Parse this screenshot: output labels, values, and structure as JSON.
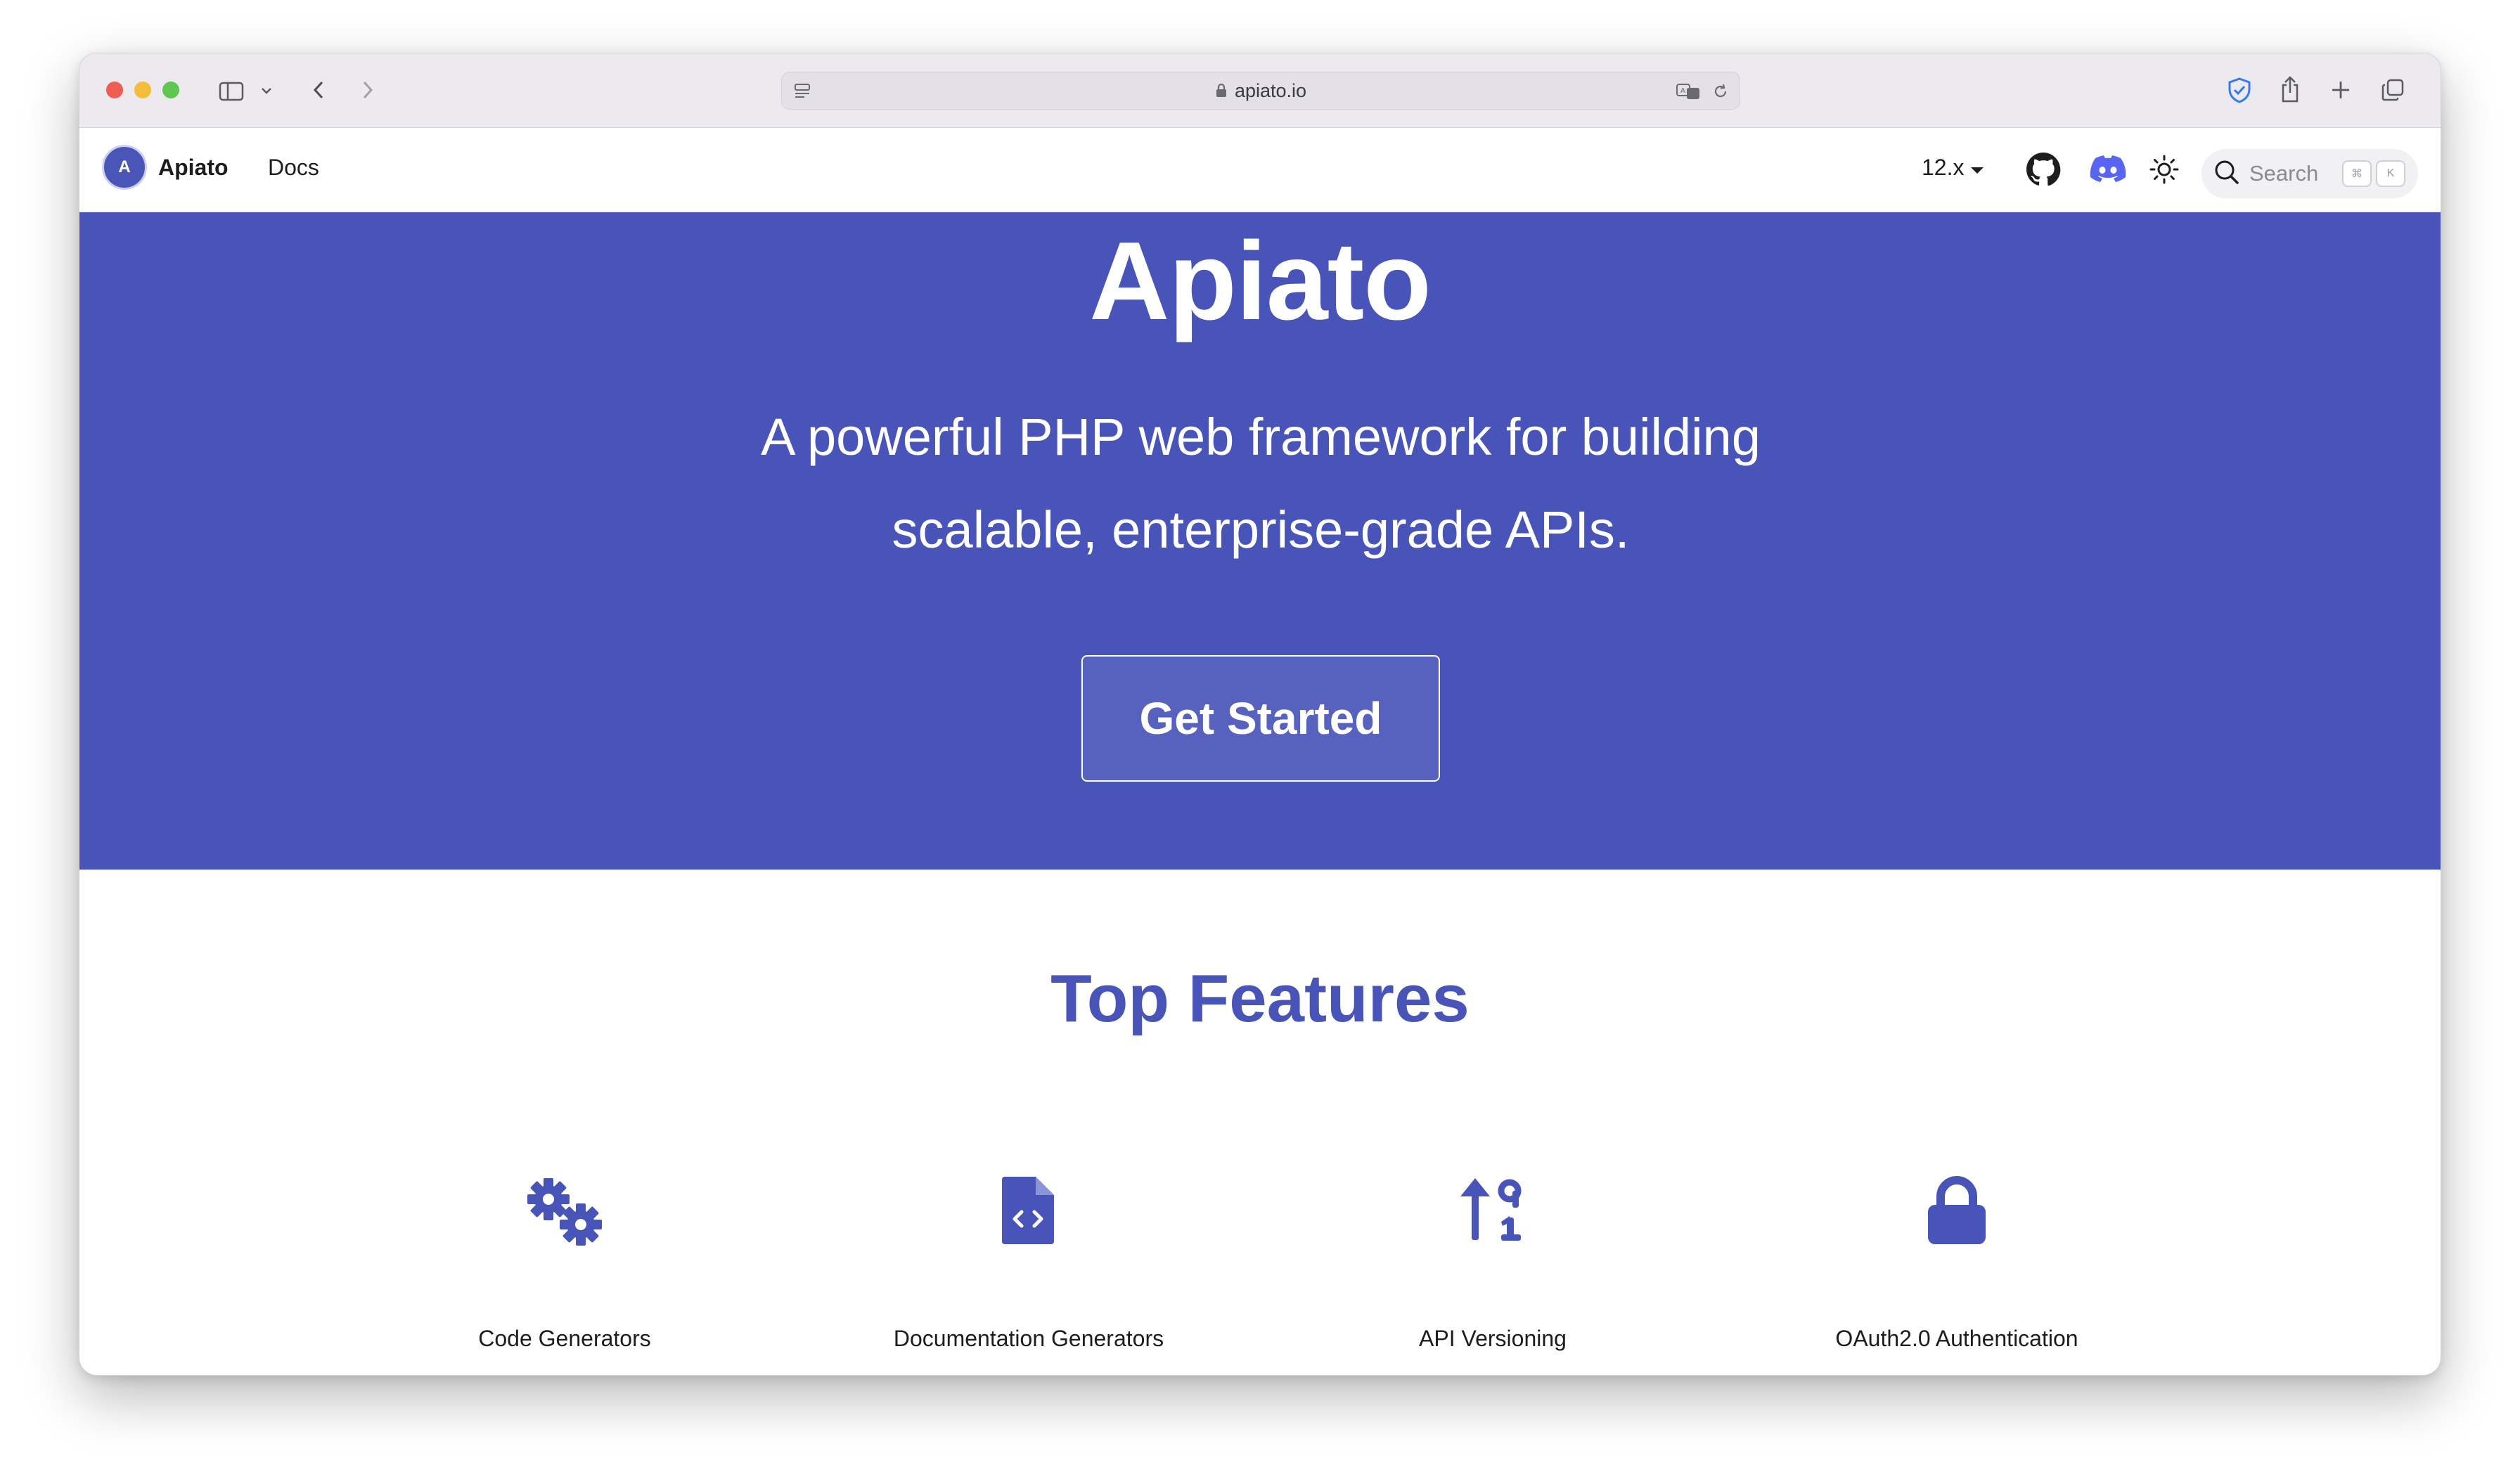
{
  "browser": {
    "url": "apiato.io"
  },
  "nav": {
    "brand": "Apiato",
    "logo_text": "A",
    "docs_label": "Docs",
    "version": "12.x",
    "search_placeholder": "Search",
    "kbd_1": "⌘",
    "kbd_2": "K"
  },
  "hero": {
    "title": "Apiato",
    "tagline": "A powerful PHP web framework for building scalable, enterprise-grade APIs.",
    "cta_label": "Get Started"
  },
  "features": {
    "title": "Top Features",
    "items": [
      {
        "label": "Code Generators",
        "icon": "gears-icon"
      },
      {
        "label": "Documentation Generators",
        "icon": "file-code-icon"
      },
      {
        "label": "API Versioning",
        "icon": "arrow-up-numbers-icon"
      },
      {
        "label": "OAuth2.0 Authentication",
        "icon": "lock-icon"
      }
    ]
  },
  "colors": {
    "brand": "#4954b9",
    "chrome": "#eceaef"
  }
}
